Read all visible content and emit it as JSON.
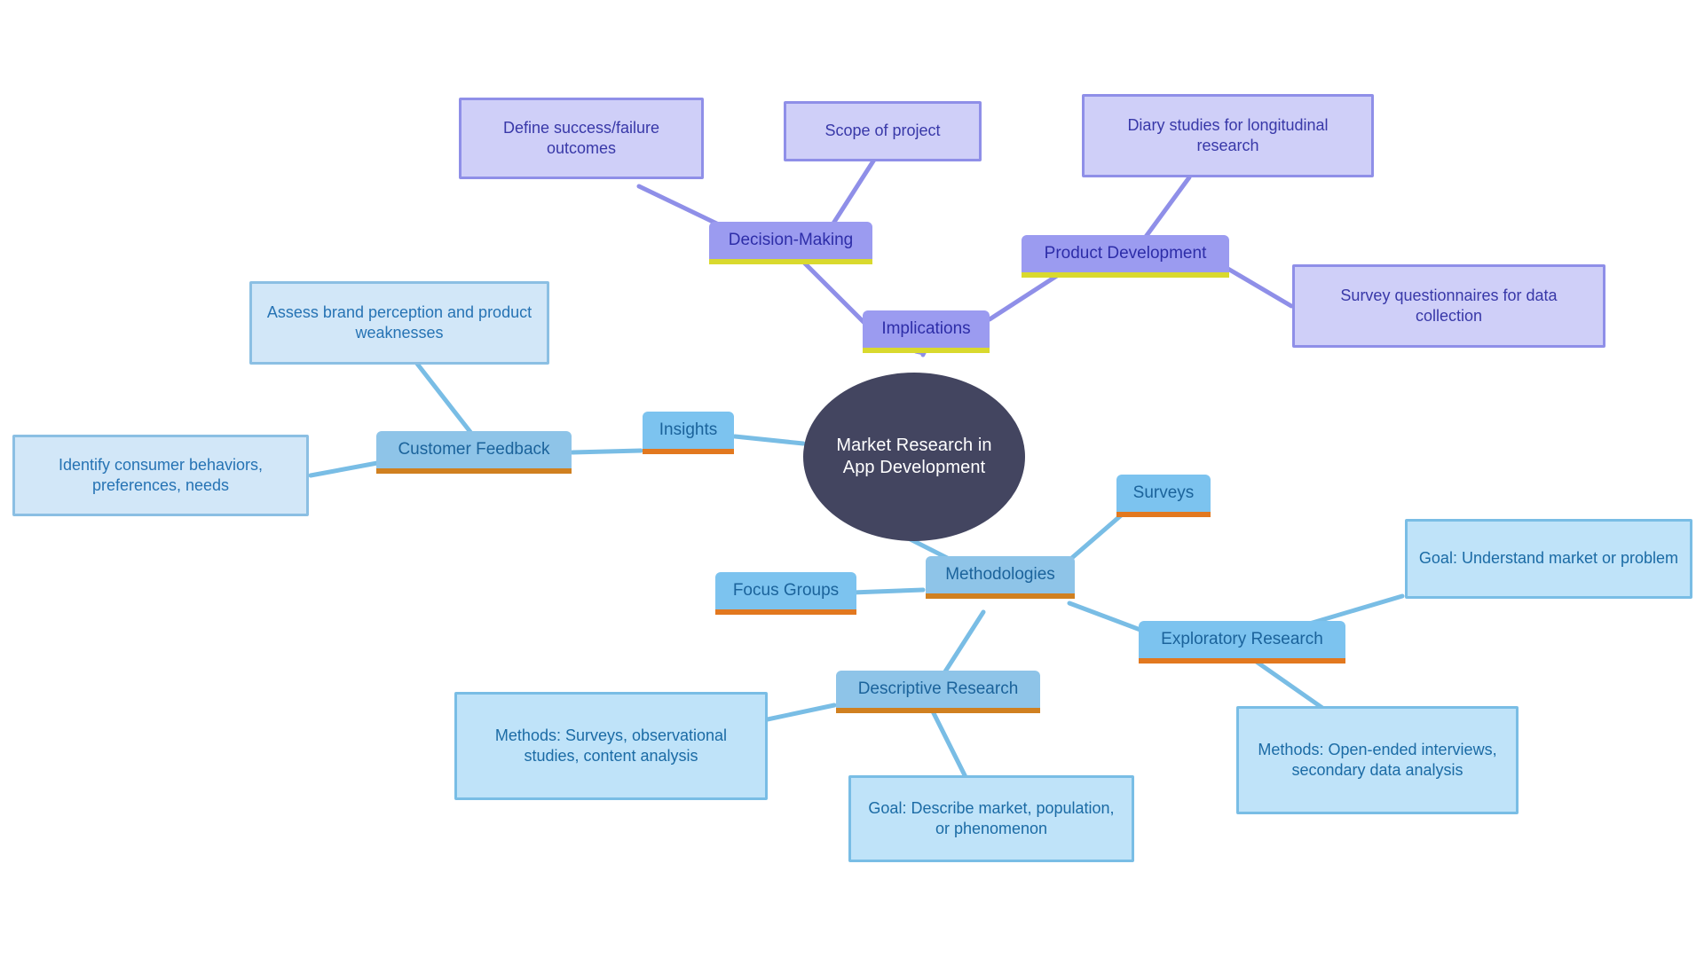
{
  "diagram": {
    "title": "Market Research in App Development",
    "type": "mind-map",
    "background_color": "#ffffff",
    "palette": {
      "root_fill": "#434560",
      "root_text": "#ffffff",
      "purple_branch_fill": "#9b9bf0",
      "purple_branch_text": "#2d2da8",
      "purple_branch_underline": "#d9d92e",
      "purple_leaf_fill": "#cfcff8",
      "purple_leaf_border": "#8f8fe8",
      "blue_branch_fill": "#7cc3ef",
      "blue_branch_text": "#1b639b",
      "blue_branch_underline": "#e2781f",
      "blue_leaf_fill": "#bfe3f9",
      "blue_leaf_border": "#79bde5",
      "purple_edge": "#8f8fe8",
      "blue_edge": "#79bde5"
    }
  },
  "root": {
    "label": "Market Research in App Development"
  },
  "nodes": {
    "implications": "Implications",
    "decision_making": "Decision-Making",
    "define_outcomes": "Define success/failure outcomes",
    "scope_of_project": "Scope of project",
    "product_development": "Product Development",
    "diary_studies": "Diary studies for longitudinal research",
    "survey_questionnaires": "Survey questionnaires for data collection",
    "insights": "Insights",
    "customer_feedback": "Customer Feedback",
    "assess_brand": "Assess brand perception and product weaknesses",
    "identify_consumer": "Identify consumer behaviors, preferences, needs",
    "methodologies": "Methodologies",
    "surveys": "Surveys",
    "focus_groups": "Focus Groups",
    "exploratory_research": "Exploratory Research",
    "exploratory_goal": "Goal: Understand market or problem",
    "exploratory_methods": "Methods: Open-ended interviews, secondary data analysis",
    "descriptive_research": "Descriptive Research",
    "descriptive_methods": "Methods: Surveys, observational studies, content analysis",
    "descriptive_goal": "Goal: Describe market, population, or phenomenon"
  }
}
